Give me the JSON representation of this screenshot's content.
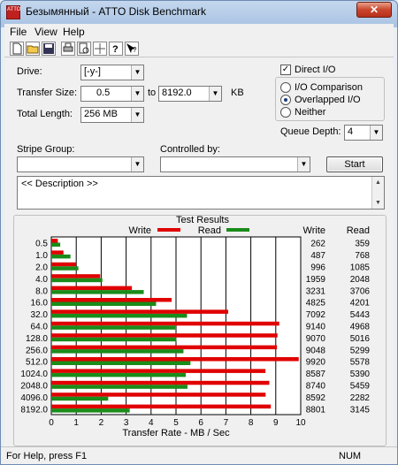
{
  "window": {
    "title": "Безымянный - ATTO Disk Benchmark",
    "app_icon_text": "ATTO",
    "close_glyph": "✕"
  },
  "menu": [
    {
      "label": "File"
    },
    {
      "label": "View"
    },
    {
      "label": "Help"
    }
  ],
  "toolbar": [
    "new-file-icon",
    "open-folder-icon",
    "save-icon",
    "print-icon",
    "print-preview-icon",
    "move-icon",
    "help-icon",
    "context-help-icon"
  ],
  "settings": {
    "drive_label": "Drive:",
    "drive_value": "[-y-]",
    "transfer_size_label": "Transfer Size:",
    "transfer_from": "0.5",
    "to_label": "to",
    "transfer_to": "8192.0",
    "transfer_unit": "KB",
    "total_length_label": "Total Length:",
    "total_length_value": "256 MB",
    "direct_io_label": "Direct I/O",
    "direct_io_checked": true,
    "io_comparison_label": "I/O Comparison",
    "overlapped_io_label": "Overlapped I/O",
    "neither_label": "Neither",
    "selected_mode": "Overlapped I/O",
    "queue_depth_label": "Queue Depth:",
    "queue_depth_value": "4",
    "stripe_group_label": "Stripe Group:",
    "stripe_group_value": "",
    "controlled_by_label": "Controlled by:",
    "controlled_by_value": "",
    "start_label": "Start",
    "description": "<< Description >>"
  },
  "results": {
    "title": "Test Results",
    "write_legend": "Write",
    "read_legend": "Read",
    "write_color": "#e00000",
    "read_color": "#1a8c1a",
    "write_col_header": "Write",
    "read_col_header": "Read"
  },
  "chart_data": {
    "type": "bar",
    "title": "Test Results",
    "xlabel": "Transfer Rate - MB / Sec",
    "xlim": [
      0,
      10
    ],
    "x_ticks": [
      "0",
      "1",
      "2",
      "3",
      "4",
      "5",
      "6",
      "7",
      "8",
      "9",
      "10"
    ],
    "categories": [
      "0.5",
      "1.0",
      "2.0",
      "4.0",
      "8.0",
      "16.0",
      "32.0",
      "64.0",
      "128.0",
      "256.0",
      "512.0",
      "1024.0",
      "2048.0",
      "4096.0",
      "8192.0"
    ],
    "series": [
      {
        "name": "Write",
        "color": "#e00000",
        "values": [
          0.262,
          0.487,
          0.996,
          1.959,
          3.231,
          4.825,
          7.092,
          9.14,
          9.07,
          9.048,
          9.92,
          8.587,
          8.74,
          8.592,
          8.801
        ]
      },
      {
        "name": "Read",
        "color": "#1a8c1a",
        "values": [
          0.359,
          0.768,
          1.085,
          2.048,
          3.706,
          4.201,
          5.443,
          4.968,
          5.016,
          5.299,
          5.578,
          5.39,
          5.459,
          2.282,
          3.145
        ]
      }
    ],
    "write_labels": [
      "262",
      "487",
      "996",
      "1959",
      "3231",
      "4825",
      "7092",
      "9140",
      "9070",
      "9048",
      "9920",
      "8587",
      "8740",
      "8592",
      "8801"
    ],
    "read_labels": [
      "359",
      "768",
      "1085",
      "2048",
      "3706",
      "4201",
      "5443",
      "4968",
      "5016",
      "5299",
      "5578",
      "5390",
      "5459",
      "2282",
      "3145"
    ],
    "grid": true
  },
  "status": {
    "text": "For Help, press F1",
    "ind1": "NUM"
  }
}
